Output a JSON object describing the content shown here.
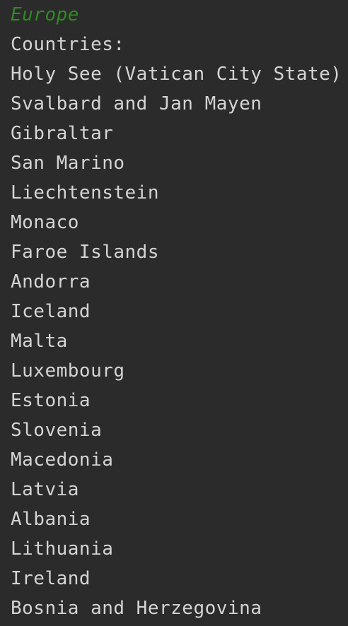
{
  "console": {
    "region_label": "Europe",
    "heading": "Countries:",
    "countries": [
      "Holy See (Vatican City State)",
      "Svalbard and Jan Mayen",
      "Gibraltar",
      "San Marino",
      "Liechtenstein",
      "Monaco",
      "Faroe Islands",
      "Andorra",
      "Iceland",
      "Malta",
      "Luxembourg",
      "Estonia",
      "Slovenia",
      "Macedonia",
      "Latvia",
      "Albania",
      "Lithuania",
      "Ireland",
      "Bosnia and Herzegovina"
    ]
  },
  "colors": {
    "background": "#2b2b2b",
    "text": "#d4d4d4",
    "region_accent": "#2e8b22"
  }
}
